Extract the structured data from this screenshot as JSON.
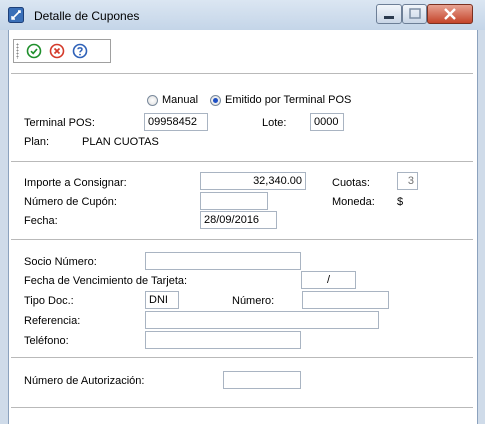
{
  "window": {
    "title": "Detalle de Cupones",
    "accent": "#cfdbe9"
  },
  "toolbar": {
    "icons": [
      "accept-icon",
      "cancel-icon",
      "help-icon"
    ],
    "accept_color": "#1f8f2c",
    "cancel_color": "#d43a2a",
    "help_color": "#2e61b8"
  },
  "source": {
    "manual_label": "Manual",
    "pos_label": "Emitido por Terminal POS",
    "selected": "pos"
  },
  "terminal": {
    "terminal_label": "Terminal POS:",
    "terminal_value": "09958452",
    "lote_label": "Lote:",
    "lote_value": "0000",
    "plan_label": "Plan:",
    "plan_value": "PLAN CUOTAS"
  },
  "amounts": {
    "importe_label": "Importe a Consignar:",
    "importe_value": "32,340.00",
    "cuotas_label": "Cuotas:",
    "cuotas_value": "3",
    "cupon_label": "Número de Cupón:",
    "cupon_value": "",
    "moneda_label": "Moneda:",
    "moneda_value": "$",
    "fecha_label": "Fecha:",
    "fecha_value": "28/09/2016"
  },
  "socio": {
    "socio_label": "Socio Número:",
    "socio_value": "",
    "vto_label": "Fecha de Vencimiento de Tarjeta:",
    "vto_value": "/",
    "tipo_label": "Tipo Doc.:",
    "tipo_value": "DNI",
    "numero_label": "Número:",
    "numero_value": "",
    "ref_label": "Referencia:",
    "ref_value": "",
    "tel_label": "Teléfono:",
    "tel_value": ""
  },
  "auth": {
    "auth_label": "Número de Autorización:",
    "auth_value": ""
  }
}
